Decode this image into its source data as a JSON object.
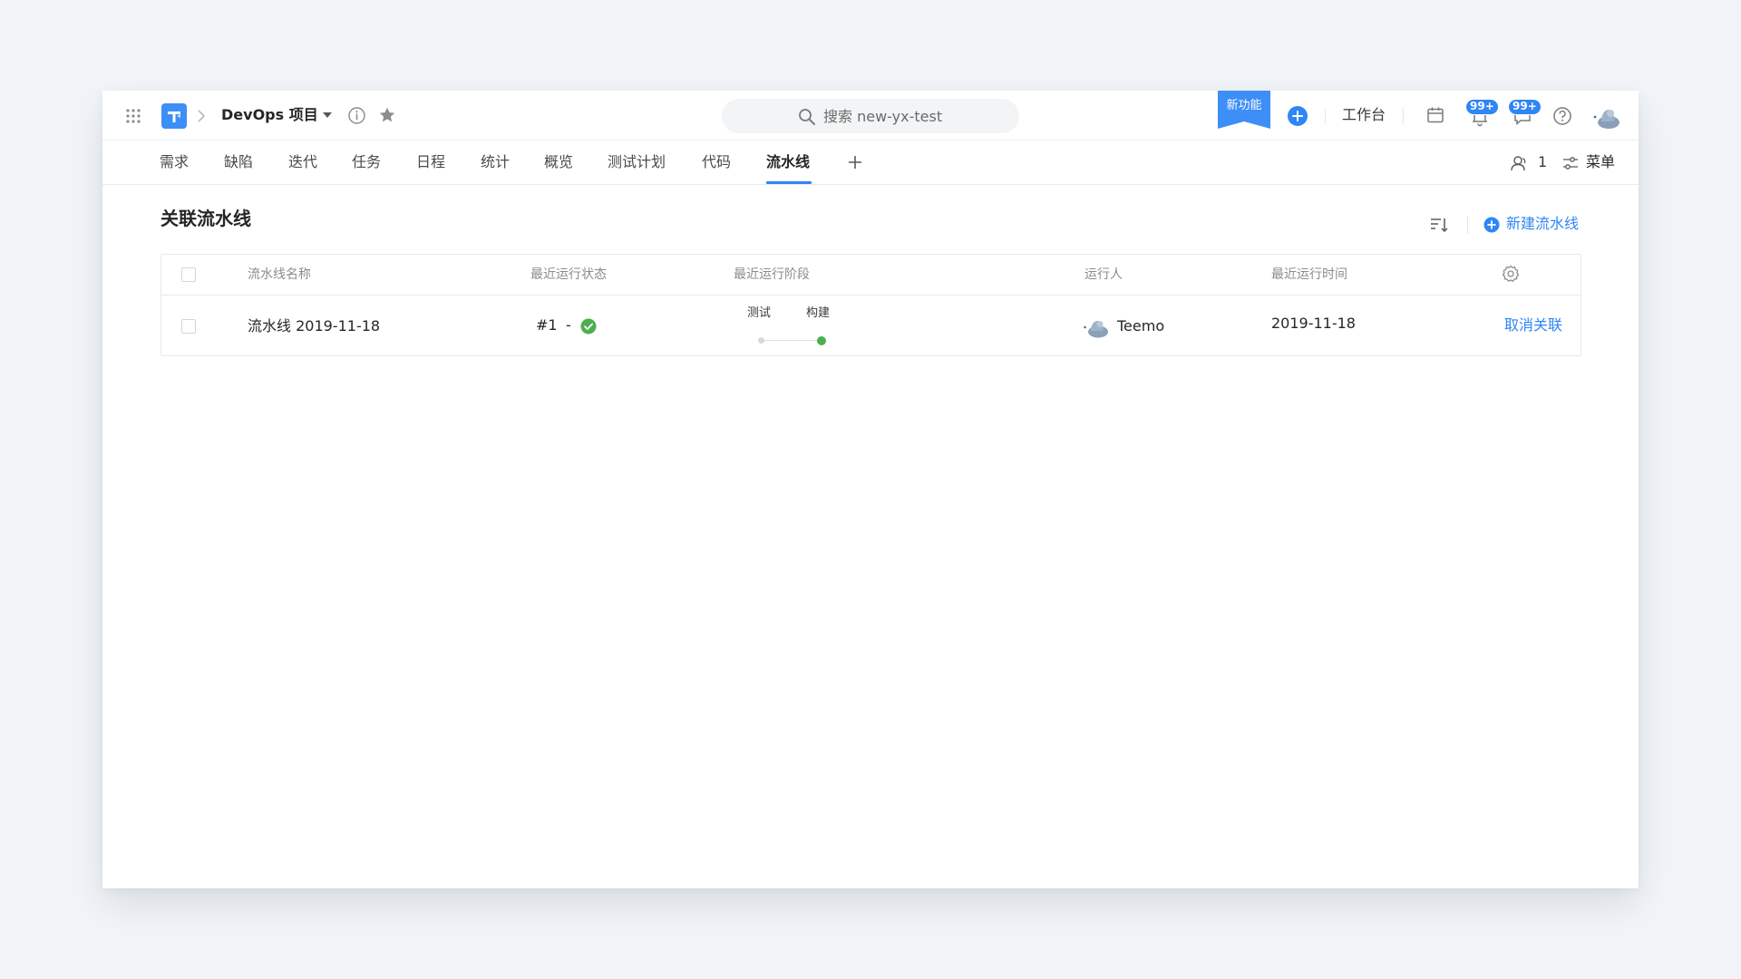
{
  "header": {
    "project_name": "DevOps 项目",
    "search_placeholder": "搜索 new-yx-test",
    "new_feature_label": "新功能",
    "workbench_label": "工作台",
    "notification_badge": "99+",
    "message_badge": "99+"
  },
  "nav": {
    "tabs": [
      {
        "label": "需求"
      },
      {
        "label": "缺陷"
      },
      {
        "label": "迭代"
      },
      {
        "label": "任务"
      },
      {
        "label": "日程"
      },
      {
        "label": "统计"
      },
      {
        "label": "概览"
      },
      {
        "label": "测试计划"
      },
      {
        "label": "代码"
      },
      {
        "label": "流水线",
        "active": true
      }
    ],
    "members_count": "1",
    "menu_label": "菜单"
  },
  "page": {
    "title": "关联流水线",
    "new_pipeline_label": "新建流水线"
  },
  "table": {
    "columns": [
      "流水线名称",
      "最近运行状态",
      "最近运行阶段",
      "运行人",
      "最近运行时间"
    ],
    "rows": [
      {
        "name": "流水线 2019-11-18",
        "run_number": "#1",
        "run_separator": "-",
        "status": "success",
        "stages": [
          "测试",
          "构建"
        ],
        "runner": "Teemo",
        "last_run_time": "2019-11-18",
        "action_label": "取消关联"
      }
    ]
  },
  "colors": {
    "accent": "#2f86f6",
    "success": "#4caf50",
    "page_background": "#f1f5f9"
  },
  "icons": [
    "app-grid-icon",
    "logo-icon",
    "chevron-right-icon",
    "caret-down-icon",
    "info-icon",
    "star-icon",
    "search-icon",
    "plus-circle-icon",
    "calendar-icon",
    "bell-icon",
    "message-icon",
    "help-icon",
    "avatar",
    "plus-icon",
    "members-icon",
    "menu-icon",
    "sort-icon",
    "settings-icon",
    "check-circle-icon"
  ]
}
